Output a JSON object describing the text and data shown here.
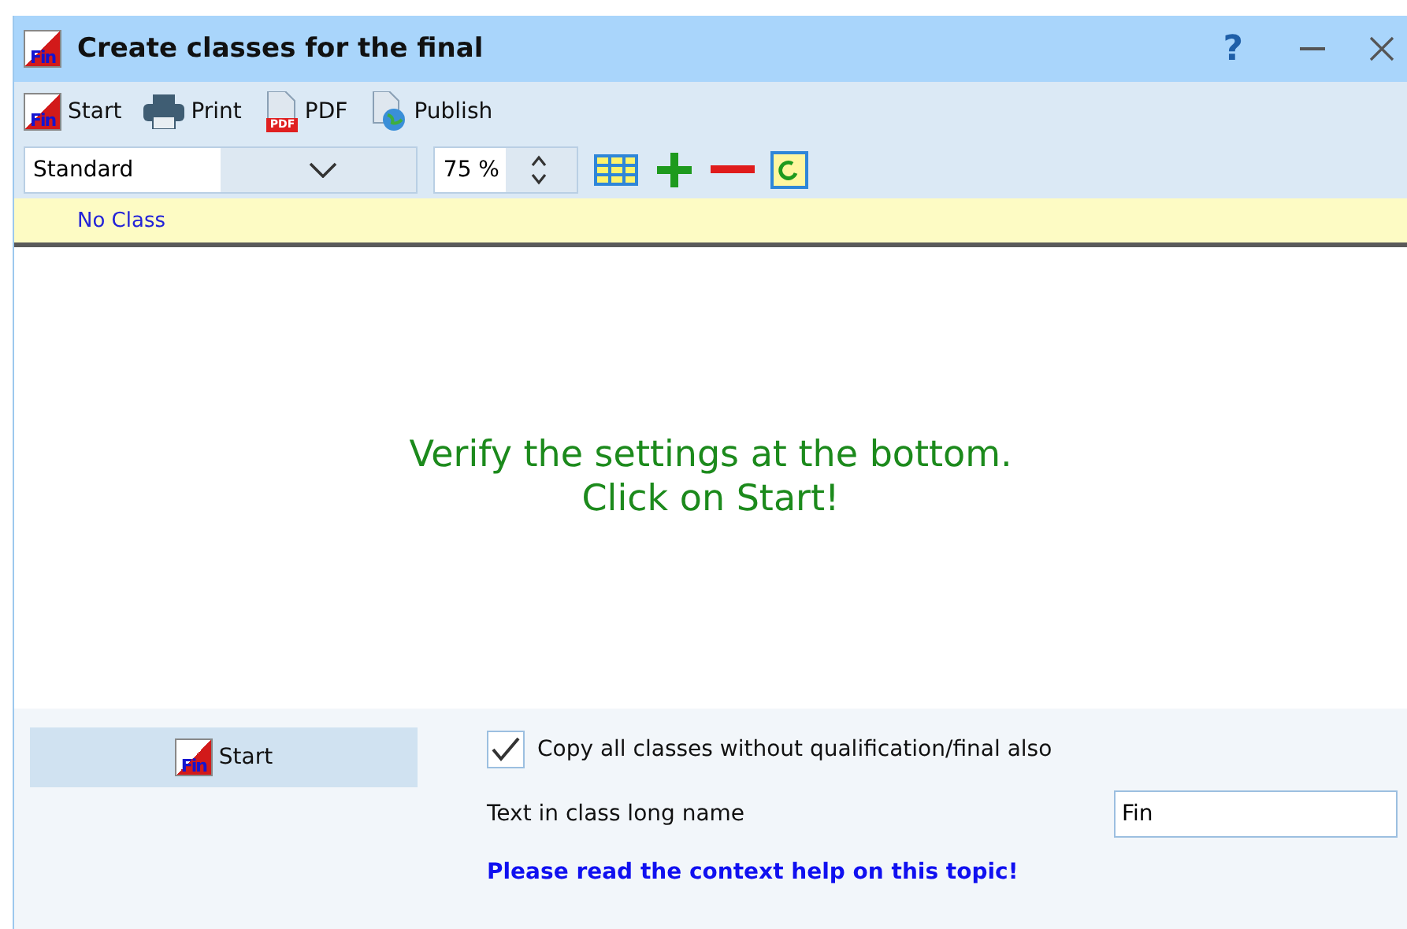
{
  "window": {
    "title": "Create classes for the final",
    "logo_text": "Fin",
    "help": "?"
  },
  "toolbar": [
    {
      "kind": "logo",
      "label": "Start",
      "logo_text": "Fin"
    },
    {
      "kind": "print",
      "label": "Print"
    },
    {
      "kind": "pdf",
      "label": "PDF",
      "badge": "PDF"
    },
    {
      "kind": "publish",
      "label": "Publish"
    }
  ],
  "view_select": {
    "value": "Standard"
  },
  "zoom_field": {
    "value": "75 %"
  },
  "class_strip": {
    "label": "No Class"
  },
  "message": [
    "Verify the settings at the bottom.",
    "Click on Start!"
  ],
  "settings": {
    "start_button": {
      "label": "Start",
      "logo_text": "Fin"
    },
    "copy_all": {
      "label": "Copy all classes without qualification/final also",
      "checked": true
    },
    "long_name": {
      "label": "Text in class long name",
      "value": "Fin"
    },
    "help_link": "Please read the context help on this topic!"
  }
}
